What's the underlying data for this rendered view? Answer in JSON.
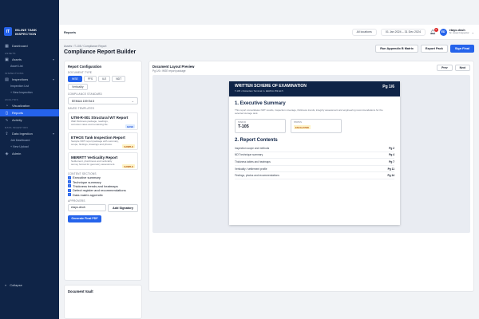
{
  "app": {
    "name": "INLINE TANK INSPECTION",
    "logo_glyph": "IT"
  },
  "sidebar": {
    "items": [
      {
        "type": "item",
        "label": "Dashboard",
        "icon": "grid-icon",
        "glyph": "▦"
      },
      {
        "type": "section",
        "label": "ASSETS"
      },
      {
        "type": "item",
        "label": "Assets",
        "icon": "box-icon",
        "glyph": "▣",
        "chevron": "▾"
      },
      {
        "type": "sub",
        "label": "Asset List"
      },
      {
        "type": "section",
        "label": "INSPECTIONS"
      },
      {
        "type": "item",
        "label": "Inspections",
        "icon": "clipboard-icon",
        "glyph": "▤",
        "chevron": "▾"
      },
      {
        "type": "sub",
        "label": "Inspection List"
      },
      {
        "type": "sub",
        "label": "+ New Inspection"
      },
      {
        "type": "section",
        "label": "ANALYSIS"
      },
      {
        "type": "item",
        "label": "Visualization",
        "icon": "chart-icon",
        "glyph": "◔"
      },
      {
        "type": "item",
        "label": "Reports",
        "icon": "file-icon",
        "glyph": "▯",
        "active": true
      },
      {
        "type": "item",
        "label": "Activity",
        "icon": "pulse-icon",
        "glyph": "∿"
      },
      {
        "type": "section",
        "label": "DATA INGESTION"
      },
      {
        "type": "item",
        "label": "Data Ingestion",
        "icon": "upload-icon",
        "glyph": "⇪",
        "chevron": "▾"
      },
      {
        "type": "sub",
        "label": "Job Dashboard"
      },
      {
        "type": "sub",
        "label": "+ New Upload"
      },
      {
        "type": "item",
        "label": "Admin",
        "icon": "shield-icon",
        "glyph": "◈"
      }
    ],
    "collapse_label": "Collapse",
    "collapse_glyph": "«"
  },
  "topbar": {
    "crumb": "Reports",
    "locations": "All locations",
    "date_range": "01 Jan 2024 – 31 Dec 2024",
    "notifications": "3",
    "user": {
      "initials": "ED",
      "name": "etayo.deuh",
      "role": "Sr. Asset Inspector"
    },
    "menu_glyph": "⌄"
  },
  "page": {
    "breadcrumb": "Assets / T-105 / Compliance Report",
    "title": "Compliance Report Builder",
    "actions": [
      "Run Appendix B Matrix",
      "Export Pack",
      "Sign Final"
    ]
  },
  "config": {
    "title": "Report Configuration",
    "doc_type_label": "DOCUMENT TYPE",
    "doc_types": [
      {
        "label": "WSE",
        "selected": true
      },
      {
        "label": "FFS",
        "selected": false
      },
      {
        "label": "ILE",
        "selected": false
      },
      {
        "label": "NDT",
        "selected": false
      },
      {
        "label": "Verticality",
        "selected": false
      }
    ],
    "standard_label": "COMPLIANCE STANDARD",
    "standard_value": "EEMUA 159 Ed.5",
    "templates_label": "SAVED TEMPLATES",
    "templates": [
      {
        "title": "UTM-R-001 Structural WT Report",
        "desc": "Wall thickness package, readings, corrosion rates and remaining life.",
        "badge": "BASE",
        "badge_color": "#1d4ed8"
      },
      {
        "title": "ETHOS Tank Inspection Report",
        "desc": "Sample NDT report package with summary, scope, findings, drawings and photos.",
        "badge": "SAMPLE",
        "badge_color": "#b45309"
      },
      {
        "title": "MERRTT Verticality Report",
        "desc": "Settlement, plumbness and verticality survey format for geometry assessment.",
        "badge": "SAMPLE",
        "badge_color": "#b45309"
      }
    ],
    "content_label": "CONTENT SECTIONS",
    "sections": [
      "Executive summary",
      "Technique summary",
      "Thickness trends and heatmaps",
      "Defect register and recommendations",
      "Data matrix appendix"
    ],
    "approvers_label": "APPROVERS",
    "approver_value": "etayo.deuh",
    "add_signatory": "Add Signatory",
    "generate": "Generate Final PDF",
    "check_glyph": "✓"
  },
  "vault": {
    "title": "Document Vault"
  },
  "preview": {
    "title": "Document Layout Preview",
    "subtitle": "Pg 1/6 • WSE report package",
    "prev": "Prev",
    "next": "Next",
    "sheet": {
      "title": "WRITTEN SCHEME OF EXAMINATION",
      "subtitle": "T-105 • Rotterdam Terminal 4 • EEMUA 159 Ed.5",
      "page": "Pg 1/6",
      "exec_heading": "1. Executive Summary",
      "exec_text": "This report consolidates NDT results, inspection coverage, thickness trends, integrity assessment and engineering recommendations for the selected storage tank.",
      "metrics": [
        {
          "label": "TANK ID",
          "value": "T-105"
        },
        {
          "label": "STATUS",
          "badge": "ESCALATED"
        }
      ],
      "contents_heading": "2. Report Contents",
      "contents": [
        {
          "label": "Inspection scope and methods",
          "page": "Pg 2"
        },
        {
          "label": "NDT technique summary",
          "page": "Pg 4"
        },
        {
          "label": "Thickness tables and heatmaps",
          "page": "Pg 7"
        },
        {
          "label": "Verticality / settlement profile",
          "page": "Pg 11"
        },
        {
          "label": "Findings, photos and recommendations",
          "page": "Pg 14"
        }
      ]
    }
  }
}
